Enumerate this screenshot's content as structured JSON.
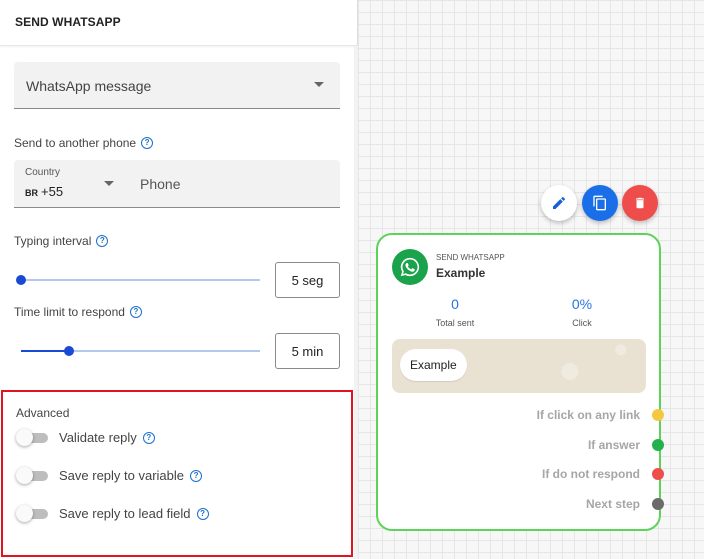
{
  "panel": {
    "title": "SEND WHATSAPP",
    "message_select": {
      "value": "WhatsApp message"
    },
    "another_phone_label": "Send to another phone",
    "country": {
      "label": "Country",
      "code": "BR",
      "dial": "+55"
    },
    "phone_placeholder": "Phone",
    "typing_interval": {
      "label": "Typing interval",
      "value": "5 seg",
      "level_fraction": 0.0
    },
    "time_limit": {
      "label": "Time limit to respond",
      "value": "5 min",
      "level_fraction": 0.2
    },
    "advanced": {
      "title": "Advanced",
      "toggles": [
        {
          "label": "Validate reply",
          "on": false
        },
        {
          "label": "Save reply to variable",
          "on": false
        },
        {
          "label": "Save reply to lead field",
          "on": false
        }
      ]
    }
  },
  "node": {
    "type_label": "SEND WHATSAPP",
    "name": "Example",
    "stats": [
      {
        "value": "0",
        "label": "Total sent"
      },
      {
        "value": "0%",
        "label": "Click"
      }
    ],
    "preview_message": "Example",
    "outputs": [
      {
        "label": "If click on any link",
        "color": "#f5c842"
      },
      {
        "label": "If answer",
        "color": "#22b14c"
      },
      {
        "label": "If do not respond",
        "color": "#ef4c4c"
      },
      {
        "label": "Next step",
        "color": "#6b6b6b"
      }
    ]
  },
  "actions": [
    {
      "name": "edit-icon",
      "color": "#ffffff"
    },
    {
      "name": "copy-icon",
      "color": "#1a6fe8"
    },
    {
      "name": "trash-icon",
      "color": "#ef4c4c"
    }
  ],
  "colors": {
    "accent": "#1a49d6",
    "node_border": "#5dd35a",
    "whatsapp": "#1aa34a",
    "highlight": "#e0141e"
  }
}
